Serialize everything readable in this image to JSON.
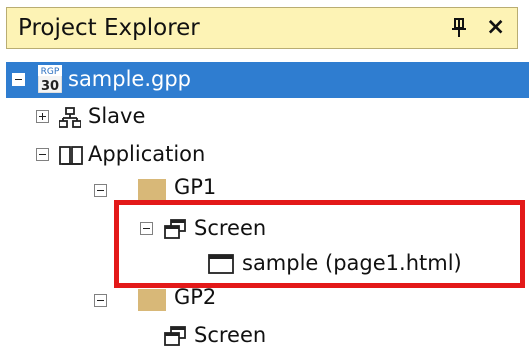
{
  "panel": {
    "title": "Project Explorer",
    "pin_icon": "pin-icon",
    "close_label": "×"
  },
  "tree": {
    "root": {
      "label": "sample.gpp",
      "badge_top": "RGP",
      "badge_bottom": "30",
      "selected": true
    },
    "slave": {
      "label": "Slave"
    },
    "application": {
      "label": "Application"
    },
    "gp1": {
      "label": "GP1"
    },
    "gp1_screen": {
      "label": "Screen"
    },
    "gp1_page": {
      "label": "sample (page1.html)"
    },
    "gp2": {
      "label": "GP2"
    },
    "gp2_screen": {
      "label": "Screen"
    }
  },
  "colors": {
    "title_bg": "#fdf3b5",
    "selection": "#2f7dd0",
    "highlight_border": "#e31919",
    "folder": "#d8b878"
  }
}
